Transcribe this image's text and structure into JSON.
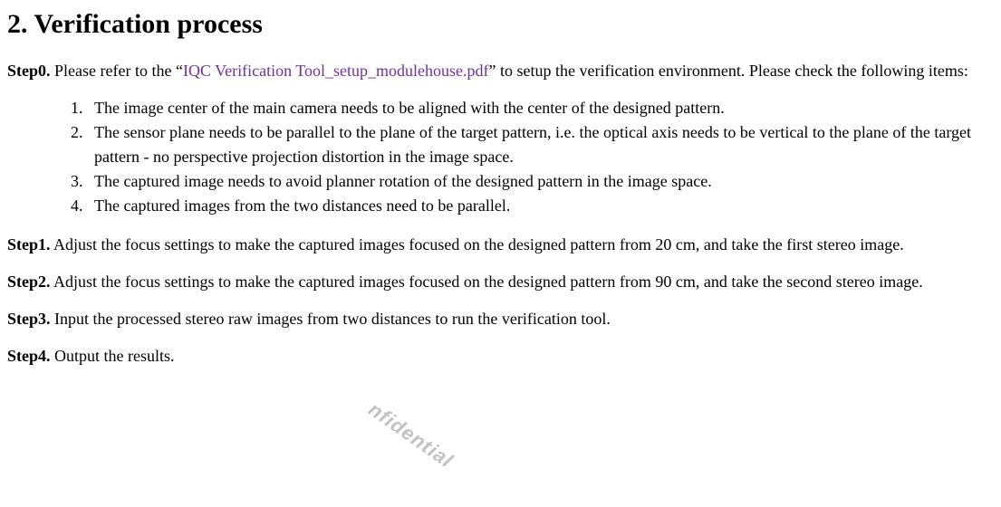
{
  "heading": "2. Verification process",
  "step0": {
    "label": "Step0.",
    "pre_link_text": " Please refer to the “",
    "link_text": "IQC Verification Tool_setup_modulehouse.pdf",
    "post_link_text": "” to setup the verification environment. Please check the following items:"
  },
  "check_items": [
    "The image center of the main camera needs to be aligned with the center of the designed pattern.",
    "The sensor plane needs to be parallel to the plane of the target pattern, i.e. the optical axis needs to be vertical to the plane of the target pattern - no perspective projection distortion in the image space.",
    "The captured image needs to avoid planner rotation of the designed pattern in the image space.",
    "The captured images from the two distances need to be parallel."
  ],
  "step1": {
    "label": "Step1.",
    "text": " Adjust the focus settings to make the captured images focused on the designed pattern from 20 cm, and take the first stereo image."
  },
  "step2": {
    "label": "Step2.",
    "text": " Adjust the focus settings to make the captured images focused on the designed pattern from 90 cm, and take the second stereo image."
  },
  "step3": {
    "label": "Step3.",
    "text": " Input the processed stereo raw images from two distances to run the verification tool."
  },
  "step4": {
    "label": "Step4.",
    "text": " Output the results."
  },
  "watermark": "nfidential"
}
